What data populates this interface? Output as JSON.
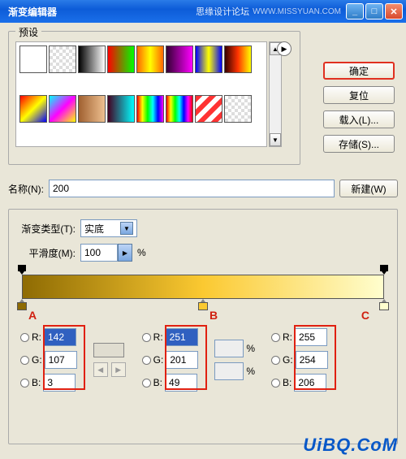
{
  "window": {
    "title": "渐变编辑器",
    "watermark_text": "思缘设计论坛",
    "watermark_url": "WWW.MISSYUAN.COM"
  },
  "buttons": {
    "ok": "确定",
    "reset": "复位",
    "load": "载入(L)...",
    "save": "存储(S)...",
    "new": "新建(W)"
  },
  "presets": {
    "title": "预设",
    "swatches": [
      "linear-gradient(to right,#000,#f00)",
      "repeating-conic-gradient(#ddd 0 25%,#fff 0 50%) 0/8px 8px",
      "linear-gradient(to right,#000,#fff)",
      "linear-gradient(to right,#f00,#0f0)",
      "linear-gradient(to right,#f60,#ff0,#f60)",
      "linear-gradient(to right,#303,#f0f)",
      "linear-gradient(to right,#00f,#ff0,#00f)",
      "linear-gradient(to right,#300,#f30,#ff0)",
      "linear-gradient(135deg,#f00,#ff0,#00f)",
      "linear-gradient(135deg,#0ff,#f0f,#ff0)",
      "linear-gradient(to right,#a06030,#eec090)",
      "linear-gradient(to right,#402,#0ff)",
      "linear-gradient(to right,#f00,#ff0,#0f0,#0ff,#00f,#f0f)",
      "linear-gradient(to right,#f00,#ff0,#0f0,#0ff,#00f,#f0f,#f00)",
      "repeating-linear-gradient(135deg,#f33 0 6px,#fff 6px 12px)",
      "repeating-conic-gradient(#ddd 0 25%,#fff 0 50%) 0/8px 8px"
    ]
  },
  "name": {
    "label": "名称(N):",
    "value": "200"
  },
  "gradtype": {
    "label": "渐变类型(T):",
    "value": "实底"
  },
  "smooth": {
    "label": "平滑度(M):",
    "value": "100",
    "unit": "%"
  },
  "stops": {
    "A": {
      "label": "A",
      "pos": 0,
      "color": "#8e6b03",
      "R": "142",
      "G": "107",
      "B": "3"
    },
    "B": {
      "label": "B",
      "pos": 50,
      "color": "#fbc931",
      "R": "251",
      "G": "201",
      "B": "49"
    },
    "C": {
      "label": "C",
      "pos": 100,
      "color": "#fffece",
      "R": "255",
      "G": "254",
      "B": "206"
    }
  },
  "rgb_labels": {
    "R": "R:",
    "G": "G:",
    "B": "B:"
  },
  "pct_unit": "%",
  "footer_watermark": "UiBQ.CoM"
}
